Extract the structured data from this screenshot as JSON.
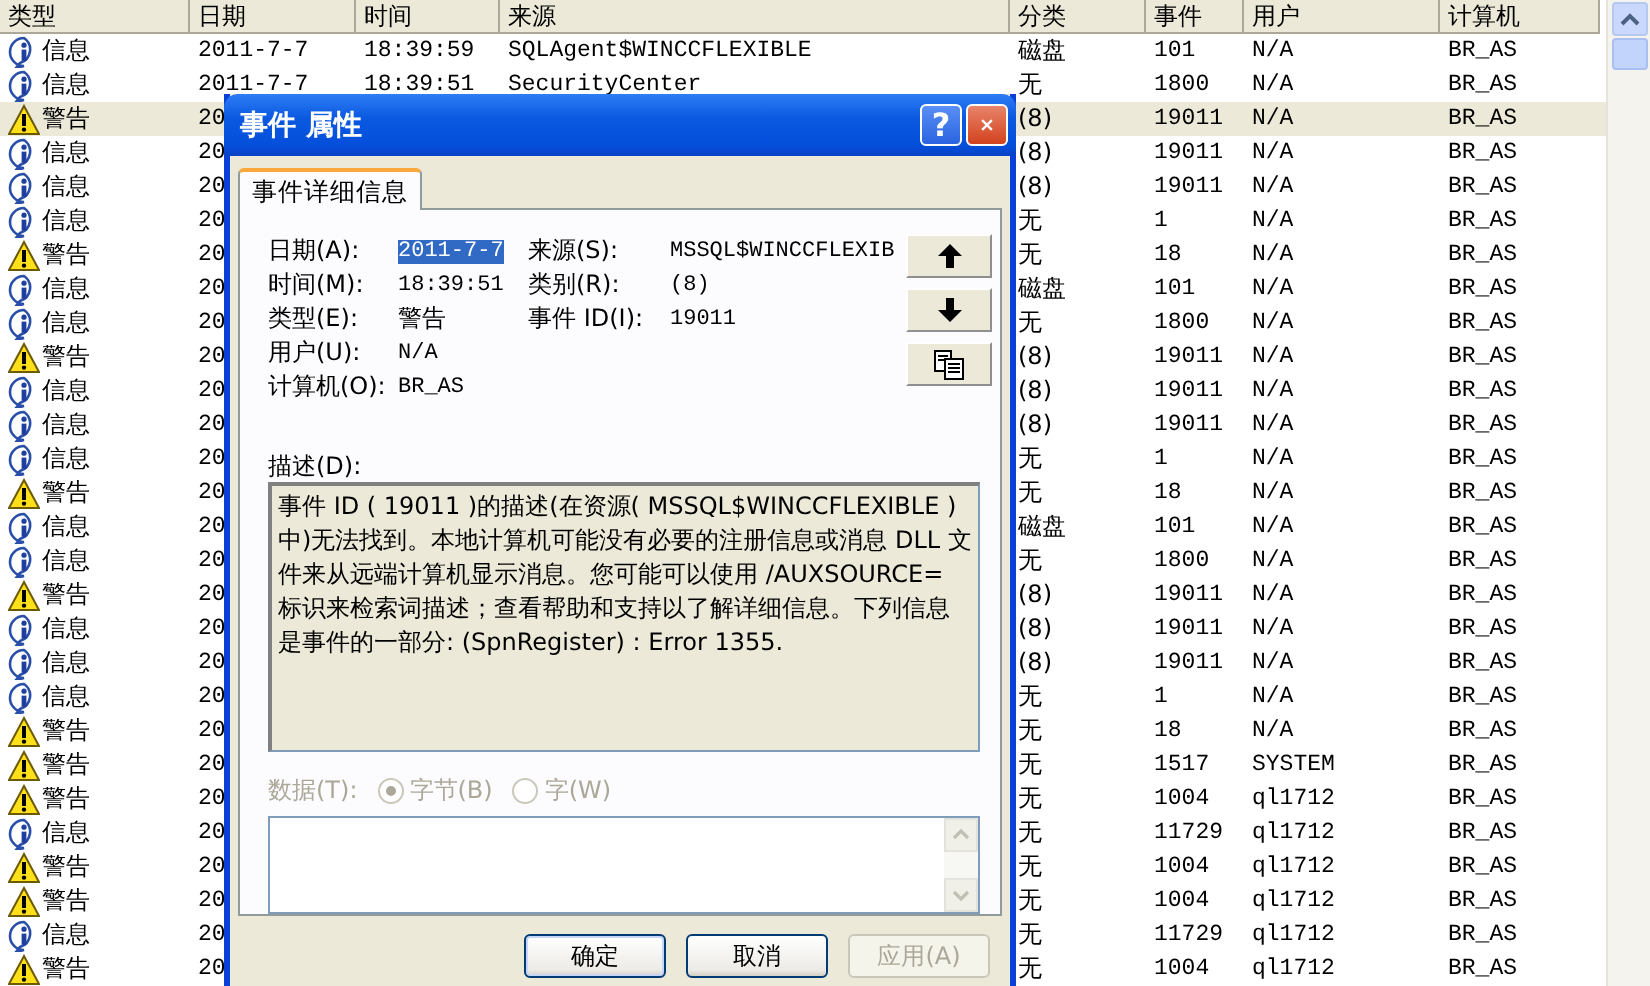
{
  "table": {
    "columns": [
      "类型",
      "日期",
      "时间",
      "来源",
      "分类",
      "事件",
      "用户",
      "计算机"
    ],
    "rows": [
      {
        "kind": "info",
        "type": "信息",
        "date": "2011-7-7",
        "time": "18:39:59",
        "source": "SQLAgent$WINCCFLEXIBLE",
        "category": "磁盘",
        "event": "101",
        "user": "N/A",
        "computer": "BR_AS",
        "selected": false
      },
      {
        "kind": "info",
        "type": "信息",
        "date": "2011-7-7",
        "time": "18:39:51",
        "source": "SecurityCenter",
        "category": "无",
        "event": "1800",
        "user": "N/A",
        "computer": "BR_AS",
        "selected": false
      },
      {
        "kind": "warning",
        "type": "警告",
        "date": "20",
        "category": "(8)",
        "event": "19011",
        "user": "N/A",
        "computer": "BR_AS",
        "selected": true
      },
      {
        "kind": "info",
        "type": "信息",
        "date": "20",
        "category": "(8)",
        "event": "19011",
        "user": "N/A",
        "computer": "BR_AS",
        "selected": false
      },
      {
        "kind": "info",
        "type": "信息",
        "date": "20",
        "category": "(8)",
        "event": "19011",
        "user": "N/A",
        "computer": "BR_AS",
        "selected": false
      },
      {
        "kind": "info",
        "type": "信息",
        "date": "20",
        "category": "无",
        "event": "1",
        "user": "N/A",
        "computer": "BR_AS",
        "selected": false
      },
      {
        "kind": "warning",
        "type": "警告",
        "date": "20",
        "category": "无",
        "event": "18",
        "user": "N/A",
        "computer": "BR_AS",
        "selected": false
      },
      {
        "kind": "info",
        "type": "信息",
        "date": "20",
        "category": "磁盘",
        "event": "101",
        "user": "N/A",
        "computer": "BR_AS",
        "selected": false
      },
      {
        "kind": "info",
        "type": "信息",
        "date": "20",
        "category": "无",
        "event": "1800",
        "user": "N/A",
        "computer": "BR_AS",
        "selected": false
      },
      {
        "kind": "warning",
        "type": "警告",
        "date": "20",
        "category": "(8)",
        "event": "19011",
        "user": "N/A",
        "computer": "BR_AS",
        "selected": false
      },
      {
        "kind": "info",
        "type": "信息",
        "date": "20",
        "category": "(8)",
        "event": "19011",
        "user": "N/A",
        "computer": "BR_AS",
        "selected": false
      },
      {
        "kind": "info",
        "type": "信息",
        "date": "20",
        "category": "(8)",
        "event": "19011",
        "user": "N/A",
        "computer": "BR_AS",
        "selected": false
      },
      {
        "kind": "info",
        "type": "信息",
        "date": "20",
        "category": "无",
        "event": "1",
        "user": "N/A",
        "computer": "BR_AS",
        "selected": false
      },
      {
        "kind": "warning",
        "type": "警告",
        "date": "20",
        "category": "无",
        "event": "18",
        "user": "N/A",
        "computer": "BR_AS",
        "selected": false
      },
      {
        "kind": "info",
        "type": "信息",
        "date": "20",
        "category": "磁盘",
        "event": "101",
        "user": "N/A",
        "computer": "BR_AS",
        "selected": false
      },
      {
        "kind": "info",
        "type": "信息",
        "date": "20",
        "category": "无",
        "event": "1800",
        "user": "N/A",
        "computer": "BR_AS",
        "selected": false
      },
      {
        "kind": "warning",
        "type": "警告",
        "date": "20",
        "category": "(8)",
        "event": "19011",
        "user": "N/A",
        "computer": "BR_AS",
        "selected": false
      },
      {
        "kind": "info",
        "type": "信息",
        "date": "20",
        "category": "(8)",
        "event": "19011",
        "user": "N/A",
        "computer": "BR_AS",
        "selected": false
      },
      {
        "kind": "info",
        "type": "信息",
        "date": "20",
        "category": "(8)",
        "event": "19011",
        "user": "N/A",
        "computer": "BR_AS",
        "selected": false
      },
      {
        "kind": "info",
        "type": "信息",
        "date": "20",
        "category": "无",
        "event": "1",
        "user": "N/A",
        "computer": "BR_AS",
        "selected": false
      },
      {
        "kind": "warning",
        "type": "警告",
        "date": "20",
        "category": "无",
        "event": "18",
        "user": "N/A",
        "computer": "BR_AS",
        "selected": false
      },
      {
        "kind": "warning",
        "type": "警告",
        "date": "20",
        "category": "无",
        "event": "1517",
        "user": "SYSTEM",
        "computer": "BR_AS",
        "selected": false
      },
      {
        "kind": "warning",
        "type": "警告",
        "date": "20",
        "category": "无",
        "event": "1004",
        "user": "ql1712",
        "computer": "BR_AS",
        "selected": false
      },
      {
        "kind": "info",
        "type": "信息",
        "date": "20",
        "category": "无",
        "event": "11729",
        "user": "ql1712",
        "computer": "BR_AS",
        "selected": false
      },
      {
        "kind": "warning",
        "type": "警告",
        "date": "20",
        "category": "无",
        "event": "1004",
        "user": "ql1712",
        "computer": "BR_AS",
        "selected": false
      },
      {
        "kind": "warning",
        "type": "警告",
        "date": "20",
        "category": "无",
        "event": "1004",
        "user": "ql1712",
        "computer": "BR_AS",
        "selected": false
      },
      {
        "kind": "info",
        "type": "信息",
        "date": "20",
        "category": "无",
        "event": "11729",
        "user": "ql1712",
        "computer": "BR_AS",
        "selected": false
      },
      {
        "kind": "warning",
        "type": "警告",
        "date": "20",
        "category": "无",
        "event": "1004",
        "user": "ql1712",
        "computer": "BR_AS",
        "selected": false
      }
    ]
  },
  "dialog": {
    "title": "事件 属性",
    "help_glyph": "?",
    "tabs": [
      {
        "label": "事件详细信息",
        "selected": true
      }
    ],
    "fields_left": [
      {
        "label": "日期(A):",
        "value": "2011-7-7",
        "highlighted": true
      },
      {
        "label": "时间(M):",
        "value": "18:39:51",
        "highlighted": false
      },
      {
        "label": "类型(E):",
        "value": "警告",
        "highlighted": false
      },
      {
        "label": "用户(U):",
        "value": "N/A",
        "highlighted": false
      },
      {
        "label": "计算机(O):",
        "value": "BR_AS",
        "highlighted": false
      }
    ],
    "fields_right": [
      {
        "label": "来源(S):",
        "value": "MSSQL$WINCCFLEXIB"
      },
      {
        "label": "类别(R):",
        "value": "(8)"
      },
      {
        "label": "事件 ID(I):",
        "value": "19011"
      }
    ],
    "nav_buttons": [
      {
        "kind": "up"
      },
      {
        "kind": "down"
      },
      {
        "kind": "copy"
      }
    ],
    "description_label": "描述(D):",
    "description": "事件 ID ( 19011 )的描述(在资源( MSSQL$WINCCFLEXIBLE )中)无法找到。本地计算机可能没有必要的注册信息或消息 DLL 文件来从远端计算机显示消息。您可能可以使用 /AUXSOURCE= 标识来检索词描述；查看帮助和支持以了解详细信息。下列信息是事件的一部分: (SpnRegister) : Error 1355.",
    "data": {
      "label": "数据(T):",
      "disabled": true,
      "options": [
        {
          "label": "字节(B)",
          "selected": true
        },
        {
          "label": "字(W)",
          "selected": false
        }
      ]
    },
    "buttons": [
      {
        "label": "确定",
        "disabled": false
      },
      {
        "label": "取消",
        "disabled": false
      },
      {
        "label": "应用(A)",
        "disabled": true
      }
    ]
  }
}
